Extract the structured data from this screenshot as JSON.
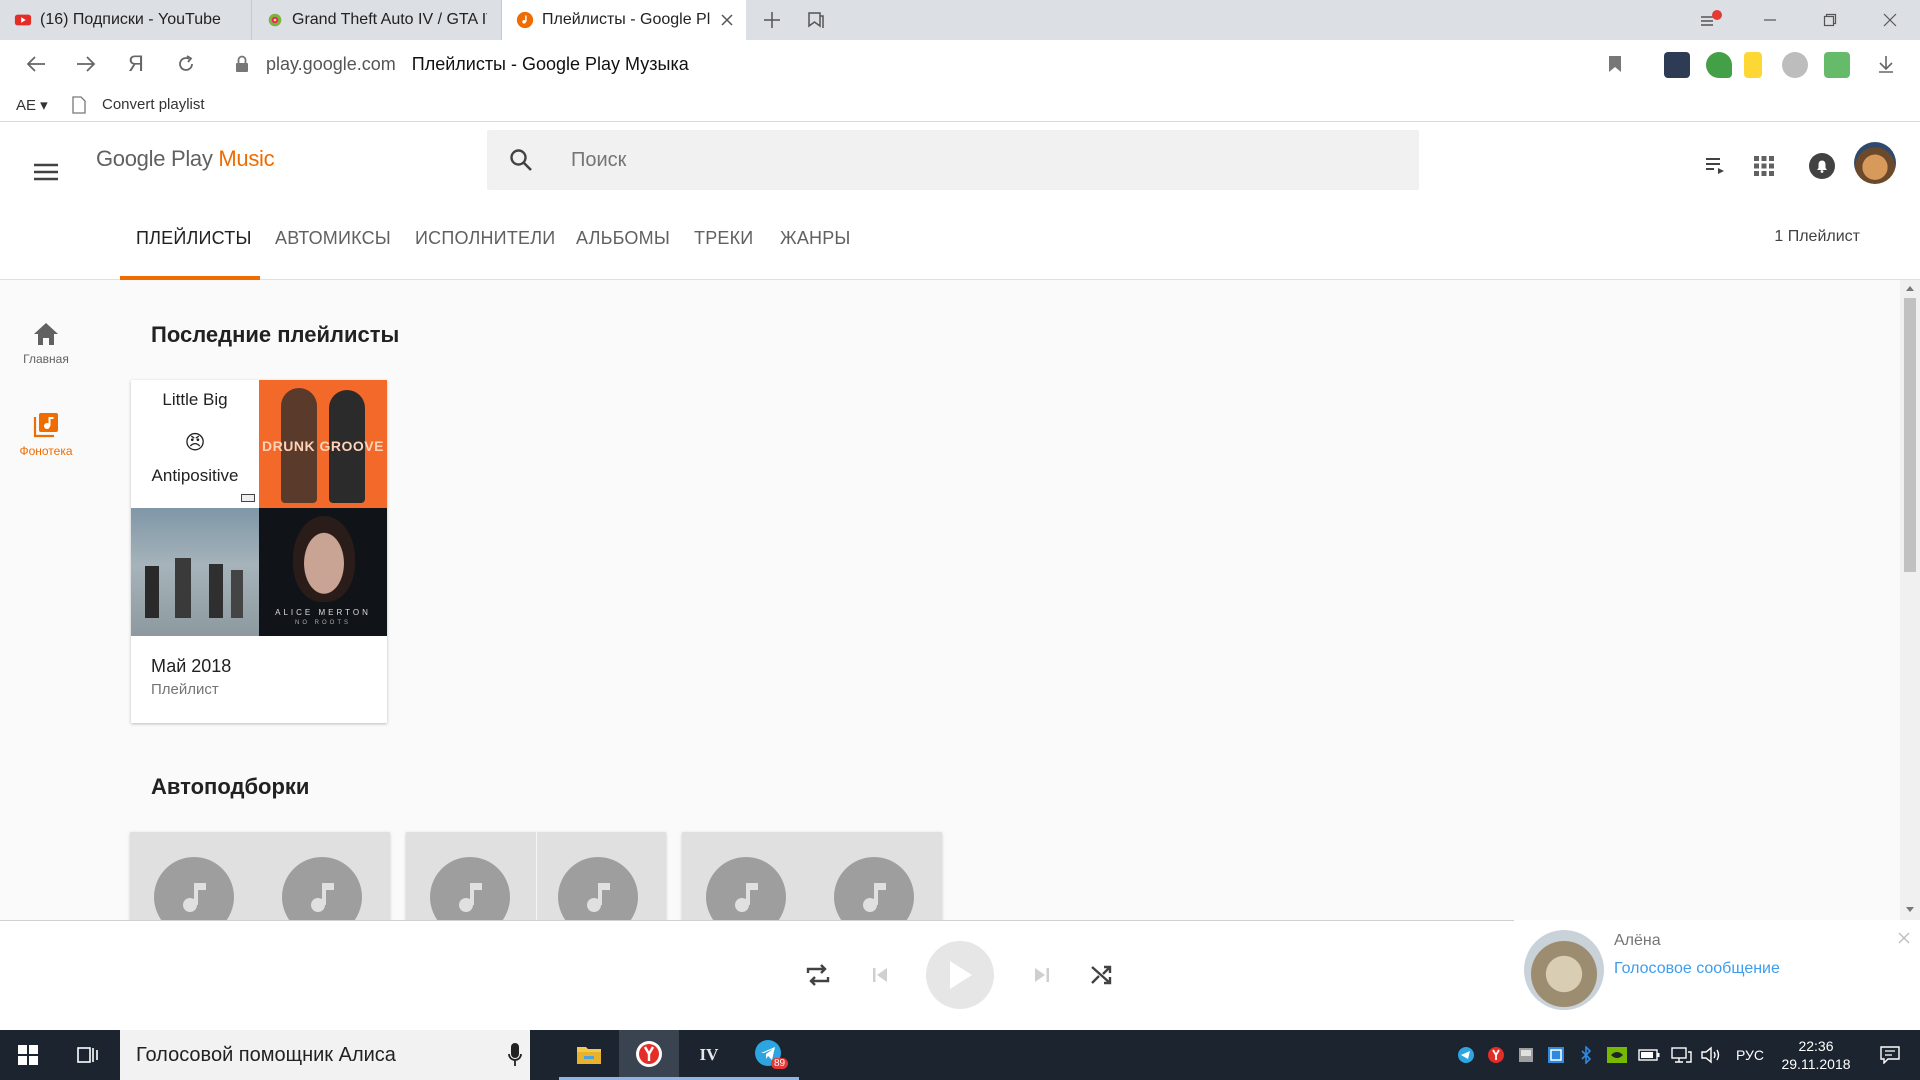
{
  "browser": {
    "tabs": [
      {
        "label": "(16) Подписки - YouTube",
        "icon": "youtube-icon",
        "active": false
      },
      {
        "label": "Grand Theft Auto IV / GTA IV",
        "icon": "gta-icon",
        "active": false
      },
      {
        "label": "Плейлисты - Google Play Музыка",
        "icon": "google-play-music-icon",
        "active": true
      }
    ],
    "url_host": "play.google.com",
    "page_title": "Плейлисты - Google Play Музыка",
    "bookmarks": {
      "folder": "AE ▾",
      "item": "Convert playlist"
    }
  },
  "app": {
    "logo": {
      "text": "Google Play",
      "accent": "Music"
    },
    "search_placeholder": "Поиск",
    "tabs": [
      "ПЛЕЙЛИСТЫ",
      "АВТОМИКСЫ",
      "ИСПОЛНИТЕЛИ",
      "АЛЬБОМЫ",
      "ТРЕКИ",
      "ЖАНРЫ"
    ],
    "playlist_count": "1 Плейлист",
    "leftnav": {
      "home": "Главная",
      "library": "Фонотека"
    },
    "recent_title": "Последние плейлисты",
    "playlist": {
      "title": "Май 2018",
      "subtitle": "Плейлист",
      "art": {
        "little_big": "Little Big",
        "emoji": "😠",
        "antipositive": "Antipositive",
        "drunk_groove": "DRUNK GROOVE",
        "alice_merton": "ALICE MERTON",
        "no_roots": "NO ROOTS"
      }
    },
    "auto_title": "Автоподборки"
  },
  "notification": {
    "name": "Алёна",
    "message": "Голосовое сообщение"
  },
  "taskbar": {
    "search": "Голосовой помощник Алиса",
    "language": "РУС",
    "time": "22:36",
    "date": "29.11.2018",
    "telegram_badge": "89"
  },
  "colors": {
    "accent": "#ef6c00",
    "link": "#3d9df0"
  }
}
